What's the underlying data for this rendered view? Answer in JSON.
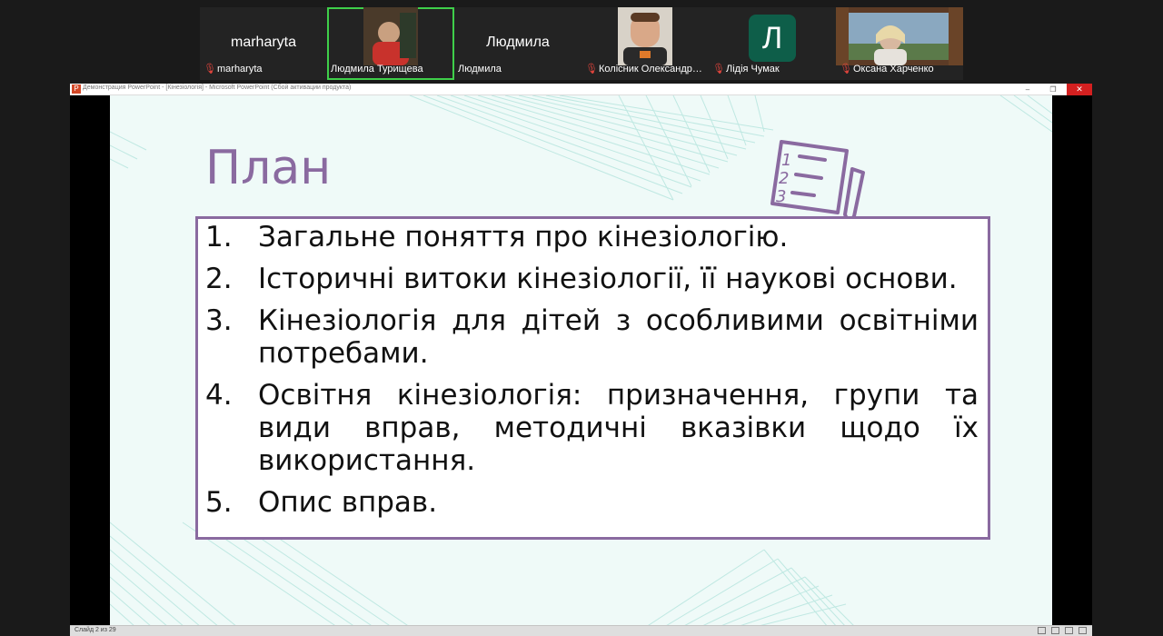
{
  "participants": [
    {
      "display": "marharyta",
      "label": "marharyta",
      "muted": true,
      "has_video": false
    },
    {
      "display": "",
      "label": "Людмила Турищева",
      "muted": false,
      "has_video": true,
      "active": true
    },
    {
      "display": "Людмила",
      "label": "Людмила",
      "muted": false,
      "has_video": false
    },
    {
      "display": "",
      "label": "Колісник Олександр…",
      "muted": true,
      "has_video": true
    },
    {
      "display": "Л",
      "label": "Лідія Чумак",
      "muted": true,
      "has_video": false
    },
    {
      "display": "",
      "label": "Оксана Харченко",
      "muted": true,
      "has_video": true
    }
  ],
  "window": {
    "title": "Демонстрация PowerPoint - [Кінезіологія] - Microsoft PowerPoint (Сбой активации продукта)",
    "min_glyph": "–",
    "restore_glyph": "❐",
    "close_glyph": "✕",
    "app_icon_letter": "P"
  },
  "slide": {
    "title": "План",
    "items": [
      {
        "num": "1.",
        "text": "Загальне поняття про кінезіологію."
      },
      {
        "num": "2.",
        "text": "Історичні витоки кінезіології, її наукові основи."
      },
      {
        "num": "3.",
        "text": "Кінезіологія для дітей з особливими освітніми потребами."
      },
      {
        "num": "4.",
        "text": "Освітня кінезіологія: призначення, групи та види вправ, методичні вказівки щодо їх використання."
      },
      {
        "num": "5.",
        "text": "Опис вправ."
      }
    ],
    "icon_numbers": [
      "1",
      "2",
      "3"
    ]
  },
  "statusbar": {
    "slide_counter": "Слайд 2 из 29"
  },
  "colors": {
    "accent": "#8a6aa0",
    "active_speaker": "#3fcf4a",
    "muted": "#e0443c",
    "avatar_bg": "#0e5e49"
  }
}
